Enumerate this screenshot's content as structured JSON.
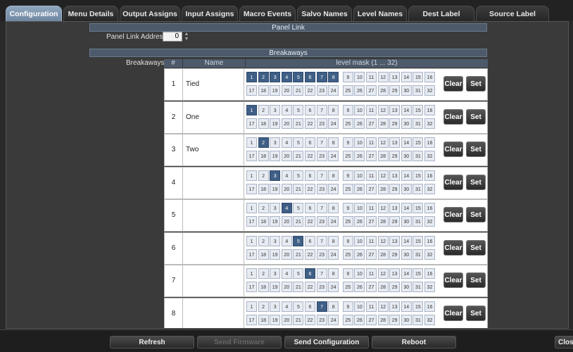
{
  "tabs": [
    {
      "label": "Configuration",
      "active": true
    },
    {
      "label": "Menu Details"
    },
    {
      "label": "Output Assigns"
    },
    {
      "label": "Input Assigns"
    },
    {
      "label": "Macro Events"
    },
    {
      "label": "Salvo Names"
    },
    {
      "label": "Level Names"
    },
    {
      "label": "Dest Label Access"
    },
    {
      "label": "Source Label Access"
    }
  ],
  "panel_link": {
    "header": "Panel Link",
    "address_label": "Panel Link Address",
    "address_value": "0"
  },
  "breakaways": {
    "header": "Breakaways",
    "label": "Breakaways",
    "columns": {
      "num": "#",
      "name": "Name",
      "mask": "level mask (1 ... 32)"
    },
    "clear_label": "Clear",
    "set_label": "Set",
    "levels": [
      "1",
      "2",
      "3",
      "4",
      "5",
      "6",
      "7",
      "8",
      "9",
      "10",
      "11",
      "12",
      "13",
      "14",
      "15",
      "16",
      "17",
      "18",
      "19",
      "20",
      "21",
      "22",
      "23",
      "24",
      "25",
      "26",
      "27",
      "28",
      "29",
      "30",
      "31",
      "32"
    ],
    "rows": [
      {
        "num": "1",
        "name": "Tied",
        "on": [
          1,
          2,
          3,
          4,
          5,
          6,
          7,
          8
        ]
      },
      {
        "num": "2",
        "name": "One",
        "on": [
          1
        ]
      },
      {
        "num": "3",
        "name": "Two",
        "on": [
          2
        ]
      },
      {
        "num": "4",
        "name": "",
        "on": [
          3
        ]
      },
      {
        "num": "5",
        "name": "",
        "on": [
          4
        ]
      },
      {
        "num": "6",
        "name": "",
        "on": [
          5
        ]
      },
      {
        "num": "7",
        "name": "",
        "on": [
          6
        ]
      },
      {
        "num": "8",
        "name": "",
        "on": [
          7
        ]
      }
    ]
  },
  "footer": {
    "refresh": "Refresh",
    "send_firmware": "Send Firmware",
    "send_configuration": "Send Configuration",
    "reboot": "Reboot",
    "close": "Close"
  }
}
